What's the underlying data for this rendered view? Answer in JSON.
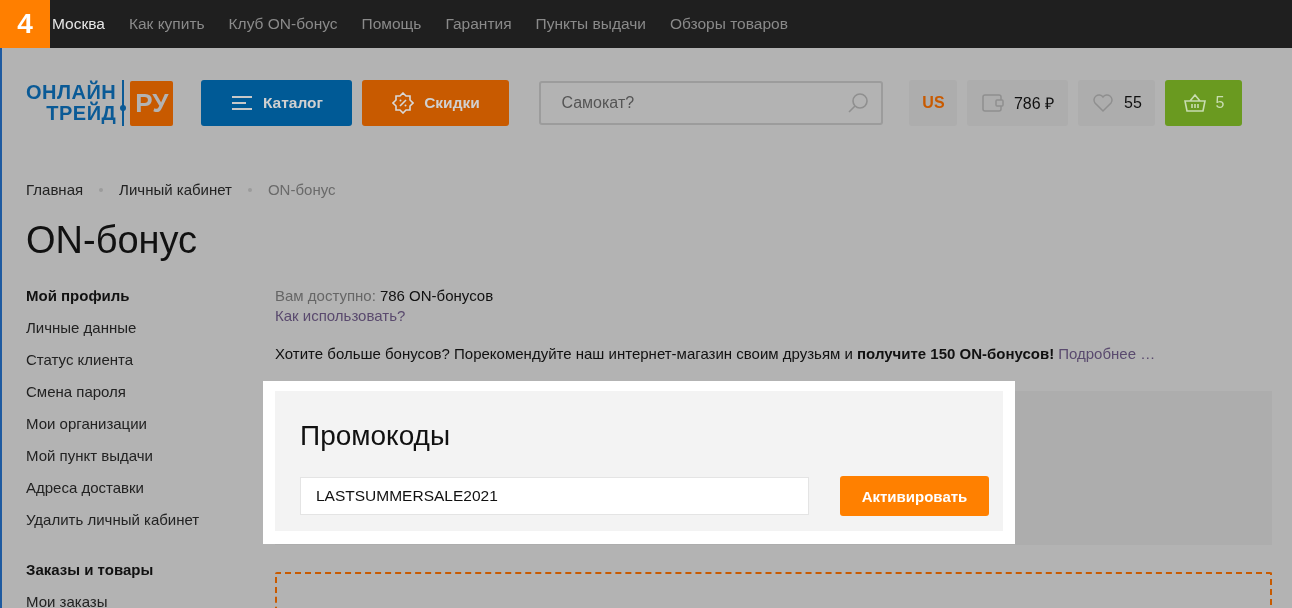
{
  "step_badge": "4",
  "top_nav": [
    {
      "label": "Москва",
      "kind": "city"
    },
    {
      "label": "Как купить",
      "kind": "link"
    },
    {
      "label": "Клуб ON-бонус",
      "kind": "link"
    },
    {
      "label": "Помощь",
      "kind": "link"
    },
    {
      "label": "Гарантия",
      "kind": "link"
    },
    {
      "label": "Пункты выдачи",
      "kind": "link"
    },
    {
      "label": "Обзоры товаров",
      "kind": "link"
    }
  ],
  "header": {
    "logo": {
      "line1": "ОНЛАЙН",
      "line2": "ТРЕЙД",
      "suffix": "РУ"
    },
    "catalog_button": "Каталог",
    "discounts_button": "Скидки",
    "search": {
      "placeholder": "Самокат?"
    },
    "currency": "US",
    "wallet": "786 ₽",
    "favorites": "55",
    "cart": "5"
  },
  "breadcrumbs": [
    {
      "label": "Главная",
      "current": false
    },
    {
      "label": "Личный кабинет",
      "current": false
    },
    {
      "label": "ON-бонус",
      "current": true
    }
  ],
  "page_title": "ON-бонус",
  "sidebar": [
    {
      "title": "Мой профиль",
      "items": [
        "Личные данные",
        "Статус клиента",
        "Смена пароля",
        "Мои организации",
        "Мой пункт выдачи",
        "Адреса доставки",
        "Удалить личный кабинет"
      ]
    },
    {
      "title": "Заказы и товары",
      "items": [
        "Мои заказы"
      ]
    }
  ],
  "bonus": {
    "available_label": "Вам доступно:",
    "available_value": "786 ON-бонусов",
    "how_link": "Как использовать?",
    "referral_text": "Хотите больше бонусов? Порекомендуйте наш интернет-магазин своим друзьям и **получите 150 ON-бонусов!**",
    "referral_link": "Подробнее …"
  },
  "promo": {
    "title": "Промокоды",
    "code": "LASTSUMMERSALE2021",
    "button": "Активировать"
  }
}
